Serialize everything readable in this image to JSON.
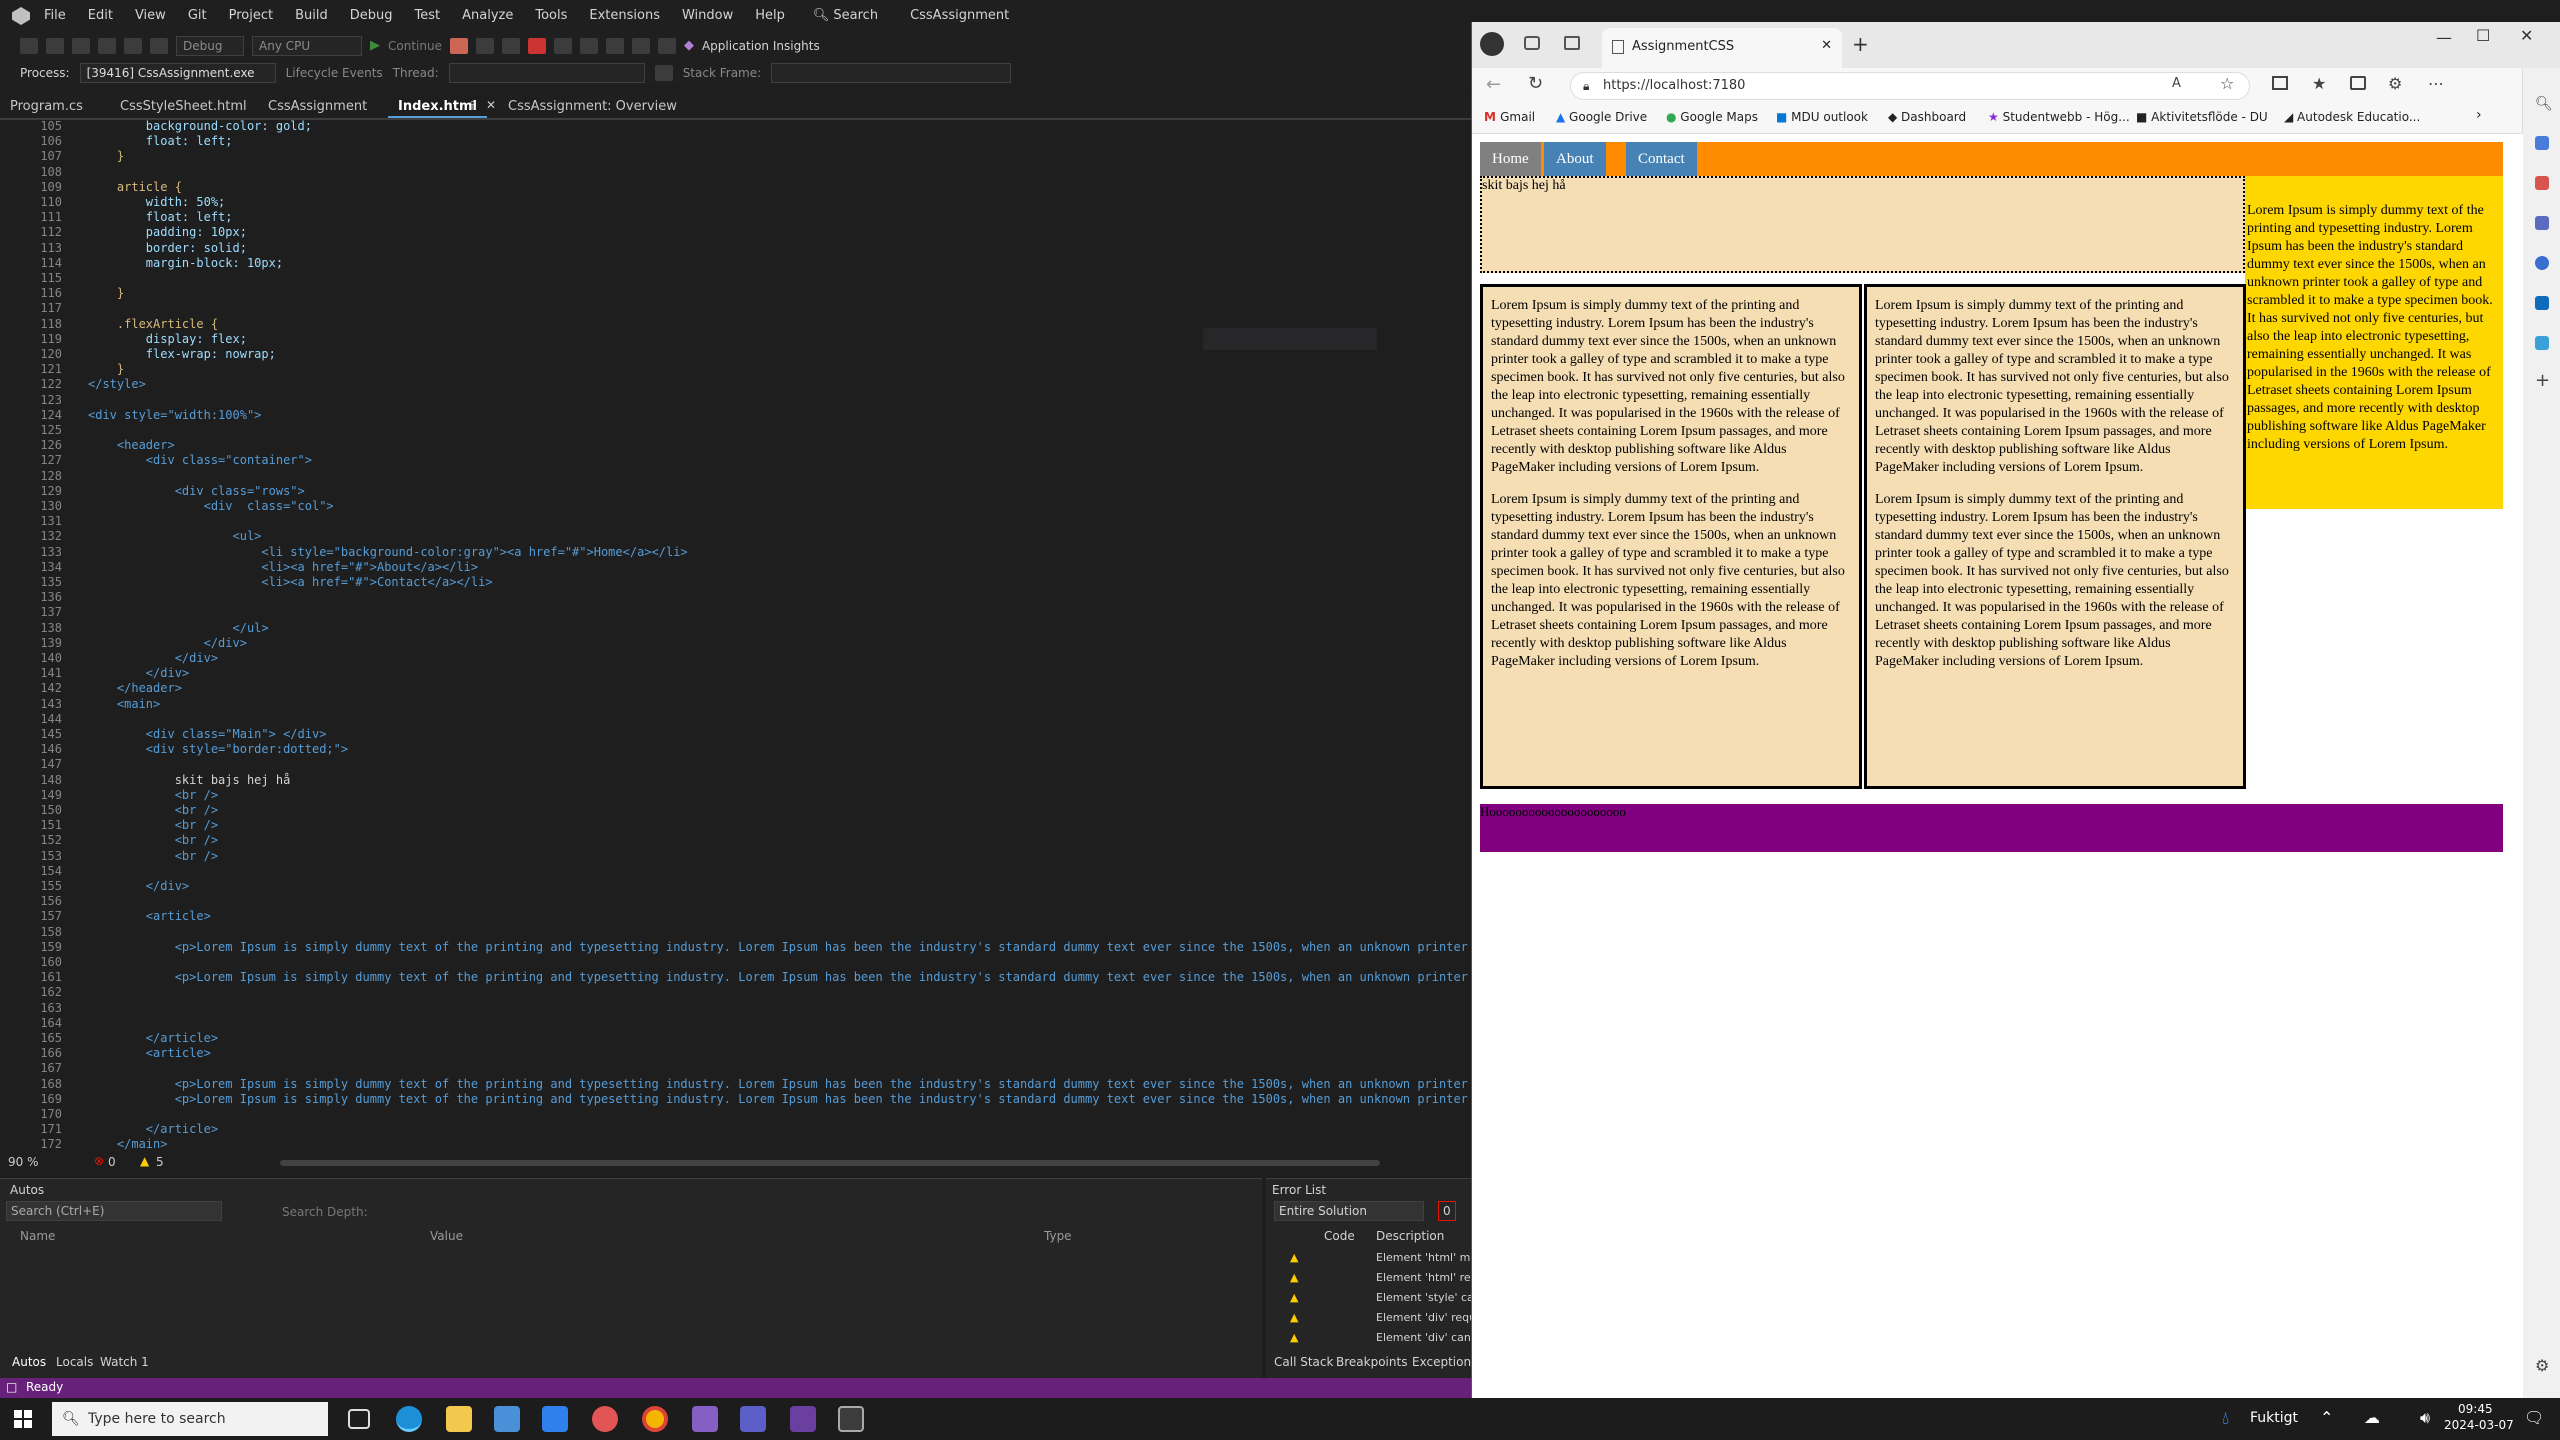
{
  "vs": {
    "title": "CssAssignment",
    "menu": [
      "File",
      "Edit",
      "View",
      "Git",
      "Project",
      "Build",
      "Debug",
      "Test",
      "Analyze",
      "Tools",
      "Extensions",
      "Window",
      "Help"
    ],
    "search_label": "Search",
    "config": "Debug",
    "platform": "Any CPU",
    "continue_label": "Continue",
    "app_insights": "Application Insights",
    "process_label": "Process:",
    "process_value": "[39416] CssAssignment.exe",
    "lifecycle_label": "Lifecycle Events",
    "thread_label": "Thread:",
    "stack_frame_label": "Stack Frame:",
    "tabs": [
      "Program.cs",
      "CssStyleSheet.html",
      "CssAssignment",
      "Index.html",
      "CssAssignment: Overview"
    ],
    "line_numbers": [
      "105",
      "106",
      "107",
      "108",
      "109",
      "110",
      "111",
      "112",
      "113",
      "114",
      "115",
      "116",
      "117",
      "118",
      "119",
      "120",
      "121",
      "122",
      "123",
      "124",
      "125",
      "126",
      "127",
      "128",
      "129",
      "130",
      "131",
      "132",
      "133",
      "134",
      "135",
      "136",
      "137",
      "138",
      "139",
      "140",
      "141",
      "142",
      "143",
      "144",
      "145",
      "146",
      "147",
      "148",
      "149",
      "150",
      "151",
      "152",
      "153",
      "154",
      "155",
      "156",
      "157",
      "158",
      "159",
      "160",
      "161",
      "162",
      "163",
      "164",
      "165",
      "166",
      "167",
      "168",
      "169",
      "170",
      "171",
      "172"
    ],
    "code_lines": [
      "        background-color: gold;",
      "        float: left;",
      "    }",
      "",
      "    article {",
      "        width: 50%;",
      "        float: left;",
      "        padding: 10px;",
      "        border: solid;",
      "        margin-block: 10px;",
      "",
      "    }",
      "",
      "    .flexArticle {",
      "        display: flex;",
      "        flex-wrap: nowrap;",
      "    }",
      "</style>",
      "",
      "<div style=\"width:100%\">",
      "",
      "    <header>",
      "        <div class=\"container\">",
      "",
      "            <div class=\"rows\">",
      "                <div  class=\"col\">",
      "",
      "                    <ul>",
      "                        <li style=\"background-color:gray\"><a href=\"#\">Home</a></li>",
      "                        <li><a href=\"#\">About</a></li>",
      "                        <li><a href=\"#\">Contact</a></li>",
      "",
      "",
      "                    </ul>",
      "                </div>",
      "            </div>",
      "        </div>",
      "    </header>",
      "    <main>",
      "",
      "        <div class=\"Main\"> </div>",
      "        <div style=\"border:dotted;\">",
      "",
      "            skit bajs hej hå",
      "            <br />",
      "            <br />",
      "            <br />",
      "            <br />",
      "            <br />",
      "",
      "        </div>",
      "",
      "        <article>",
      "",
      "            <p>Lorem Ipsum is simply dummy text of the printing and typesetting industry. Lorem Ipsum has been the industry's standard dummy text ever since the 1500s, when an unknown printer took",
      "",
      "            <p>Lorem Ipsum is simply dummy text of the printing and typesetting industry. Lorem Ipsum has been the industry's standard dummy text ever since the 1500s, when an unknown printer took",
      "",
      "",
      "",
      "        </article>",
      "        <article>",
      "",
      "            <p>Lorem Ipsum is simply dummy text of the printing and typesetting industry. Lorem Ipsum has been the industry's standard dummy text ever since the 1500s, when an unknown printer took",
      "            <p>Lorem Ipsum is simply dummy text of the printing and typesetting industry. Lorem Ipsum has been the industry's standard dummy text ever since the 1500s, when an unknown printer took",
      "",
      "        </article>",
      "    </main>"
    ],
    "zoom": "90 %",
    "errors": "0",
    "warnings": "5",
    "autos_title": "Autos",
    "autos_search": "Search (Ctrl+E)",
    "search_depth": "Search Depth:",
    "col_name": "Name",
    "col_value": "Value",
    "col_type": "Type",
    "bottom_tabs": [
      "Autos",
      "Locals",
      "Watch 1"
    ],
    "error_list_title": "Error List",
    "error_scope": "Entire Solution",
    "error_badge": "0",
    "err_col_code": "Code",
    "err_col_desc": "Description",
    "error_items": [
      "Element 'html' m",
      "Element 'html' re",
      "Element 'style' ca",
      "Element 'div' requ",
      "Element 'div' cann"
    ],
    "err_bottom_tabs": [
      "Call Stack",
      "Breakpoints",
      "Exception S"
    ],
    "status": "Ready"
  },
  "browser": {
    "tab_title": "AssignmentCSS",
    "url": "https://localhost:7180",
    "favorites": [
      "Gmail",
      "Google Drive",
      "Google Maps",
      "MDU outlook",
      "Dashboard",
      "Studentwebb - Hög...",
      "Aktivitetsflöde - DU",
      "Autodesk Educatio..."
    ],
    "page": {
      "nav": [
        "Home",
        "About",
        "Contact"
      ],
      "dotted_text": "skit bajs hej hå",
      "lorem": "Lorem Ipsum is simply dummy text of the printing and typesetting industry. Lorem Ipsum has been the industry's standard dummy text ever since the 1500s, when an unknown printer took a galley of type and scrambled it to make a type specimen book. It has survived not only five centuries, but also the leap into electronic typesetting, remaining essentially unchanged. It was popularised in the 1960s with the release of Letraset sheets containing Lorem Ipsum passages, and more recently with desktop publishing software like Aldus PageMaker including versions of Lorem Ipsum.",
      "aside_text": "Lorem Ipsum is simply dummy text of the printing and typesetting industry. Lorem Ipsum has been the industry's standard dummy text ever since the 1500s, when an unknown printer took a galley of type and scrambled it to make a type specimen book. It has survived not only five centuries, but also the leap into electronic typesetting, remaining essentially unchanged. It was popularised in the 1960s with the release of Letraset sheets containing Lorem Ipsum passages, and more recently with desktop publishing software like Aldus PageMaker including versions of Lorem Ipsum.",
      "footer_text": "Hooooooooooooooooooooo"
    }
  },
  "taskbar": {
    "search_placeholder": "Type here to search",
    "weather": "Fuktigt",
    "time": "09:45",
    "date": "2024-03-07"
  },
  "colors": {
    "vs_status": "#68217a",
    "nav_bg": "#ff8c00",
    "nav_item": "#4682b4",
    "wheat": "#f5deb3",
    "gold": "#ffd700",
    "purple": "#800080"
  }
}
